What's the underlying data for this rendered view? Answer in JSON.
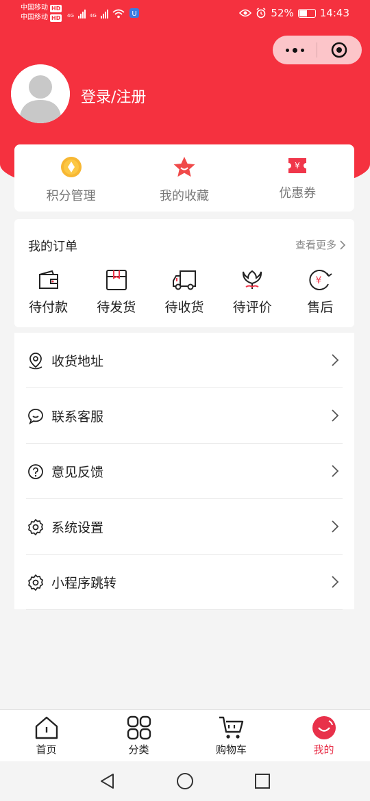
{
  "status_bar": {
    "carrier1": "中国移动",
    "carrier2": "中国移动",
    "hd": "HD",
    "net1": "4G",
    "net2": "4G",
    "battery": "52%",
    "time": "14:43"
  },
  "profile": {
    "login_text": "登录/注册"
  },
  "quick_actions": [
    {
      "label": "积分管理",
      "icon": "points-icon"
    },
    {
      "label": "我的收藏",
      "icon": "star-icon"
    },
    {
      "label": "优惠券",
      "icon": "coupon-icon"
    }
  ],
  "orders": {
    "title": "我的订单",
    "more": "查看更多",
    "items": [
      {
        "label": "待付款",
        "icon": "wallet-icon"
      },
      {
        "label": "待发货",
        "icon": "package-icon"
      },
      {
        "label": "待收货",
        "icon": "truck-icon"
      },
      {
        "label": "待评价",
        "icon": "flower-icon"
      },
      {
        "label": "售后",
        "icon": "refund-icon"
      }
    ]
  },
  "menu": [
    {
      "label": "收货地址",
      "icon": "location-icon"
    },
    {
      "label": "联系客服",
      "icon": "chat-icon"
    },
    {
      "label": "意见反馈",
      "icon": "question-icon"
    },
    {
      "label": "系统设置",
      "icon": "gear-icon"
    },
    {
      "label": "小程序跳转",
      "icon": "gear-icon"
    }
  ],
  "tabbar": [
    {
      "label": "首页",
      "icon": "home-icon"
    },
    {
      "label": "分类",
      "icon": "grid-icon"
    },
    {
      "label": "购物车",
      "icon": "cart-icon"
    },
    {
      "label": "我的",
      "icon": "profile-icon",
      "active": true
    }
  ],
  "colors": {
    "brand": "#f5313f",
    "active_tab": "#e8314a",
    "points_gold": "#f7b733"
  }
}
